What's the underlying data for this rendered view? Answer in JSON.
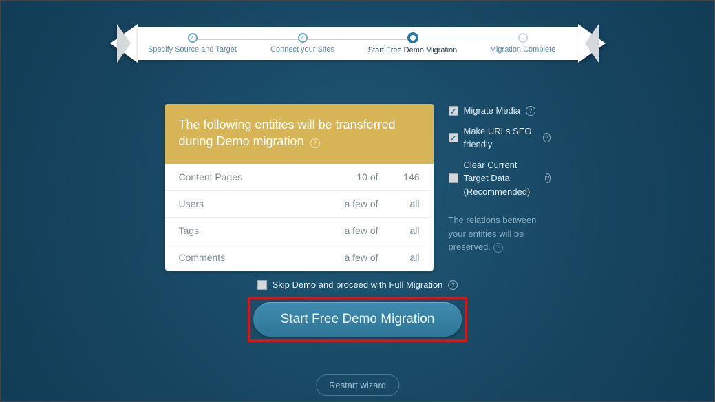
{
  "stepper": {
    "steps": [
      {
        "label": "Specify Source and Target",
        "state": "done"
      },
      {
        "label": "Connect your Sites",
        "state": "done"
      },
      {
        "label": "Start Free Demo Migration",
        "state": "active"
      },
      {
        "label": "Migration Complete",
        "state": "pending"
      }
    ]
  },
  "card": {
    "heading": "The following entities will be transferred during Demo migration",
    "rows": [
      {
        "name": "Content Pages",
        "demo": "10 of",
        "full": "146"
      },
      {
        "name": "Users",
        "demo": "a few of",
        "full": "all"
      },
      {
        "name": "Tags",
        "demo": "a few of",
        "full": "all"
      },
      {
        "name": "Comments",
        "demo": "a few of",
        "full": "all"
      }
    ]
  },
  "options": {
    "migrate_media": {
      "label": "Migrate Media",
      "checked": true
    },
    "seo_urls": {
      "label": "Make URLs SEO friendly",
      "checked": true
    },
    "clear_target": {
      "label": "Clear Current Target Data (Recommended)",
      "checked": false
    },
    "note": "The relations between your entities will be preserved."
  },
  "skip": {
    "label": "Skip Demo and proceed with Full Migration",
    "checked": false
  },
  "cta_label": "Start Free Demo Migration",
  "restart_label": "Restart wizard"
}
